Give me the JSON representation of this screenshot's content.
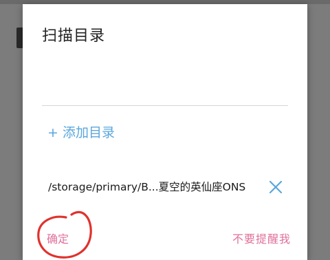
{
  "dialog": {
    "title": "扫描目录",
    "add_directory_label": "+ 添加目录",
    "path_text": "/storage/primary/B...夏空的英仙座ONS",
    "confirm_label": "确定",
    "no_remind_label": "不要提醒我"
  },
  "colors": {
    "accent_blue": "#5aa6dc",
    "action_pink": "#e0709a",
    "annotation_red": "#e0322e"
  },
  "icons": {
    "remove": "close-icon"
  }
}
